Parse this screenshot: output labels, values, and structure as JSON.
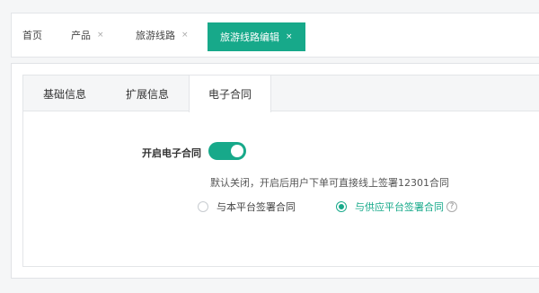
{
  "page_tabs": [
    {
      "label": "首页",
      "closable": false,
      "active": false
    },
    {
      "label": "产品",
      "closable": true,
      "active": false
    },
    {
      "label": "旅游线路",
      "closable": true,
      "active": false
    },
    {
      "label": "旅游线路编辑",
      "closable": true,
      "active": true
    }
  ],
  "close_glyph": "×",
  "sub_tabs": [
    {
      "label": "基础信息",
      "active": false
    },
    {
      "label": "扩展信息",
      "active": false
    },
    {
      "label": "电子合同",
      "active": true
    }
  ],
  "contract": {
    "label": "开启电子合同",
    "enabled": true,
    "hint": "默认关闭，开启后用户下单可直接线上签署12301合同",
    "options": [
      {
        "label": "与本平台签署合同",
        "selected": false
      },
      {
        "label": "与供应平台签署合同",
        "selected": true
      }
    ],
    "help_glyph": "?"
  },
  "colors": {
    "accent": "#17a98a",
    "background": "#f5f6f7"
  },
  "icons": [
    "close-icon",
    "help-icon"
  ]
}
